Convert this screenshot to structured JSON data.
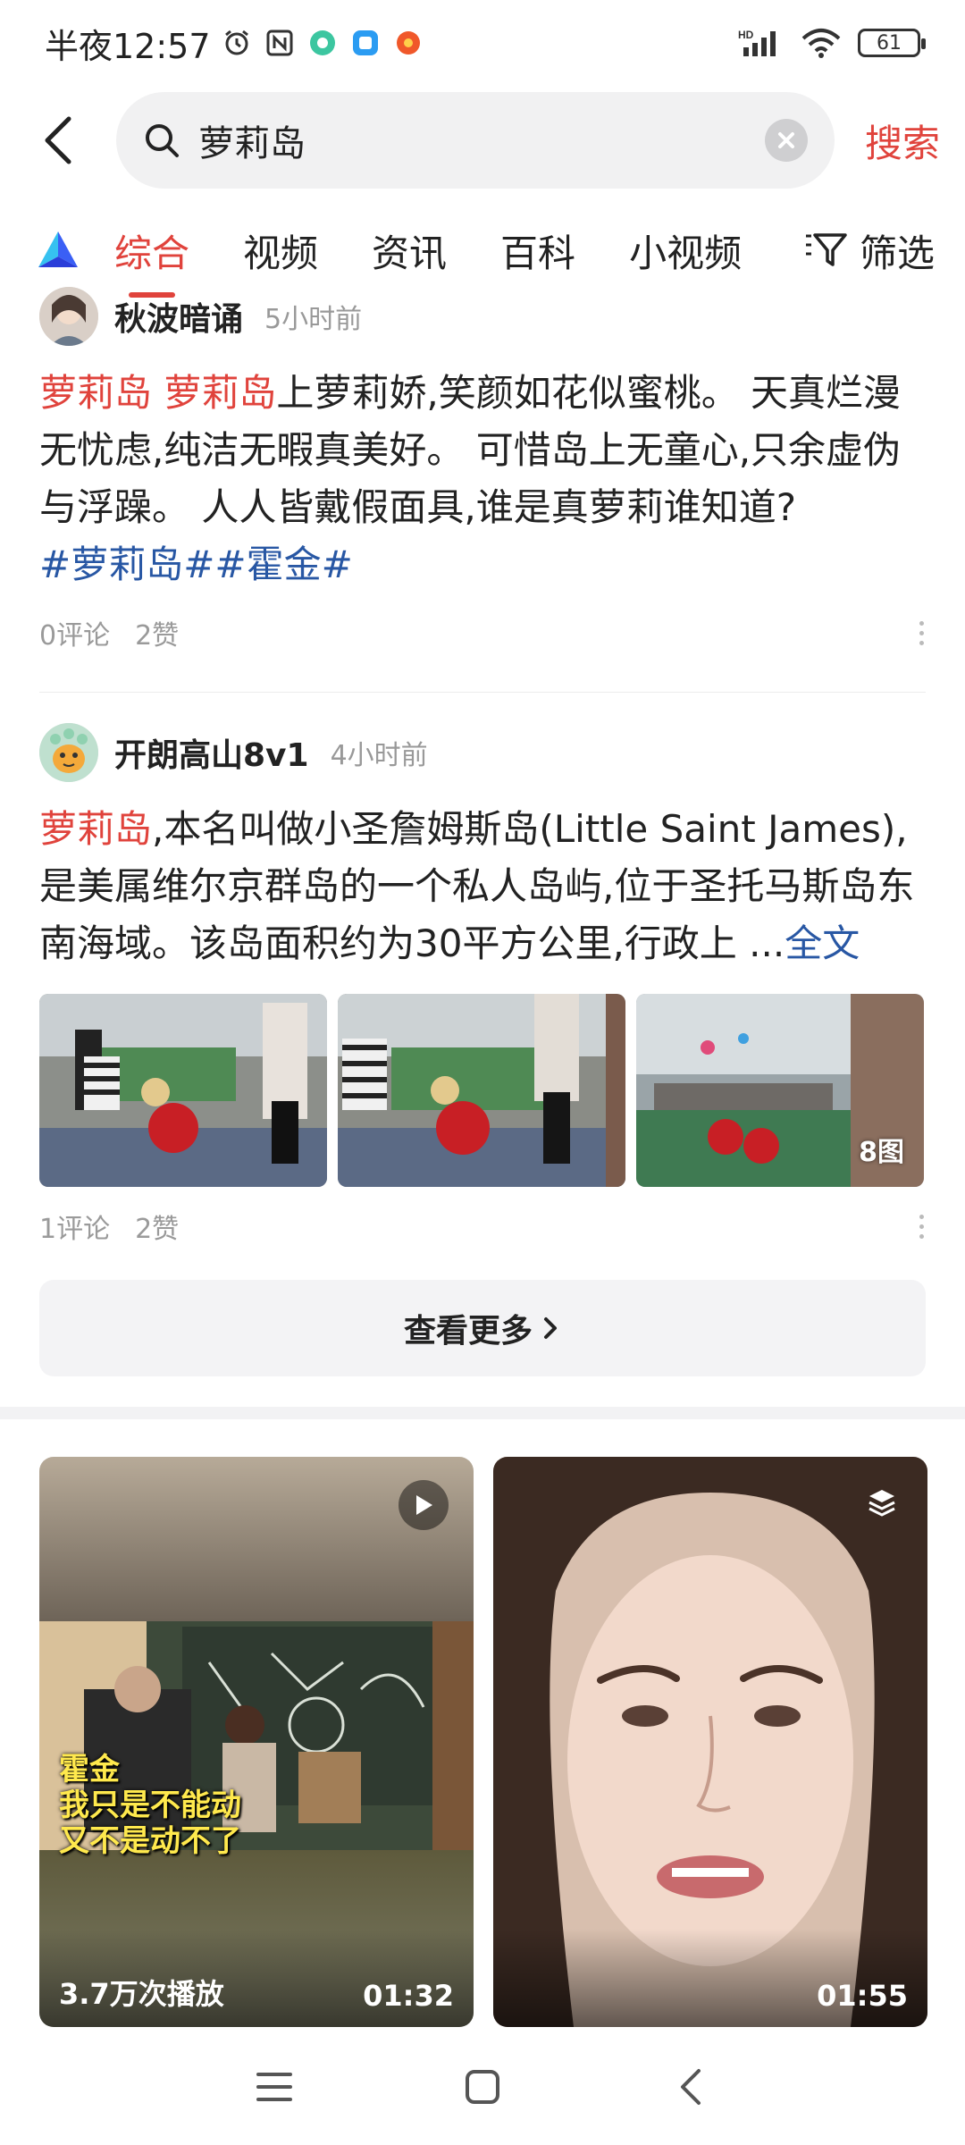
{
  "status_bar": {
    "time": "半夜12:57",
    "battery": "61",
    "network": "HD"
  },
  "search": {
    "query": "萝莉岛",
    "submit_label": "搜索"
  },
  "tabs": [
    {
      "label": "综合",
      "active": true
    },
    {
      "label": "视频"
    },
    {
      "label": "资讯"
    },
    {
      "label": "百科"
    },
    {
      "label": "小视频"
    }
  ],
  "filter_label": "筛选",
  "posts": [
    {
      "author": "秋波暗诵",
      "time": "5小时前",
      "highlight": "萝莉岛 萝莉岛",
      "text": "上萝莉娇,笑颜如花似蜜桃。 天真烂漫无忧虑,纯洁无暇真美好。 可惜岛上无童心,只余虚伪与浮躁。 人人皆戴假面具,谁是真萝莉谁知道?",
      "tags": "#萝莉岛##霍金#",
      "comments": "0评论",
      "likes": "2赞"
    },
    {
      "author": "开朗高山8v1",
      "time": "4小时前",
      "highlight": "萝莉岛",
      "text": ",本名叫做小圣詹姆斯岛(Little Saint James),是美属维尔京群岛的一个私人岛屿,位于圣托马斯岛东南海域。该岛面积约为30平方公里,行政上 ...",
      "more": "全文",
      "image_count": "8图",
      "comments": "1评论",
      "likes": "2赞"
    }
  ],
  "see_more": "查看更多",
  "videos": [
    {
      "caption_line1": "霍金",
      "caption_line2": "我只是不能动",
      "caption_line3": "又不是动不了",
      "plays": "3.7万次播放",
      "duration": "01:32"
    },
    {
      "duration": "01:55"
    }
  ],
  "colors": {
    "accent": "#e0433c",
    "tag": "#2857a4"
  }
}
